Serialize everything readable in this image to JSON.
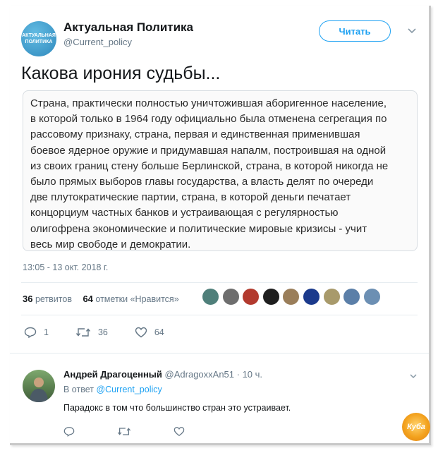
{
  "author": {
    "name": "Актуальная Политика",
    "handle": "@Current_policy",
    "avatar_text": "АКТУАЛЬНАЯ ПОЛИТИКА"
  },
  "follow_button": "Читать",
  "tweet": {
    "text": "Какова ирония судьбы...",
    "quote_lines": [
      "Страна, практически полностью уничтожившая аборигенное население,",
      "в которой только в 1964 году официально была отменена сегрегация по",
      "рассовому признаку, страна, первая и единственная применившая",
      "боевое ядерное оружие и придумавшая напалм, построившая на одной",
      "из своих границ стену больше Берлинской, страна, в которой никогда не",
      "было прямых выборов главы государства, а власть делят по очереди",
      "две плутократические партии, страна, в которой деньги печатает",
      "концорциум частных банков и устраивающая с регулярностью",
      "олигофрена экономические и политические мировые кризисы - учит",
      "весь мир свободе и демократии."
    ],
    "timestamp": "13:05 - 13 окт. 2018 г."
  },
  "stats": {
    "retweets_count": "36",
    "retweets_label": "ретвитов",
    "likes_count": "64",
    "likes_label": "отметки «Нравится»"
  },
  "liker_colors": [
    "#4f7f7a",
    "#6e6e6e",
    "#b23a2e",
    "#1f1f1f",
    "#9a7e5a",
    "#1b3a8c",
    "#a89a6b",
    "#5b7fa8",
    "#6c8fb3"
  ],
  "actions": {
    "reply_count": "1",
    "retweet_count": "36",
    "like_count": "64"
  },
  "reply": {
    "name": "Андрей Драгоценный",
    "handle": "@AdragoxxAn51",
    "time": "· 10 ч.",
    "in_reply_prefix": "В ответ",
    "in_reply_to": "@Current_policy",
    "text": "Парадокс в том что большинство стран это устраивает."
  },
  "watermark": "Куба",
  "colors": {
    "accent": "#1da1f2",
    "muted": "#657786",
    "text": "#14171a"
  }
}
